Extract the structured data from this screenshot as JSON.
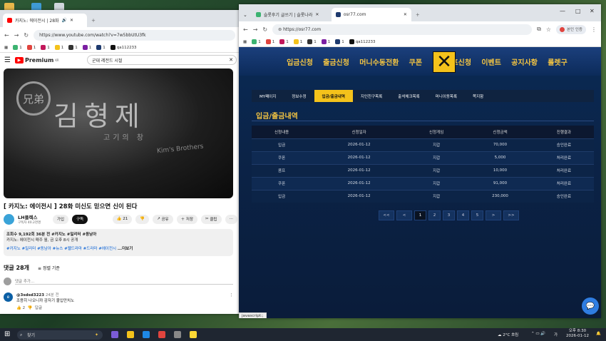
{
  "youtube_window": {
    "tab_title": "카지노: 에이전시 | 28화",
    "url": "https://www.youtube.com/watch?v=7w5bbUtU3fk",
    "bookmarks": [
      "1",
      "1",
      "1",
      "1",
      "1",
      "1",
      "1",
      "qa112233"
    ],
    "logo": "Premium",
    "logo_suffix": "KR",
    "search_query": "군대 레전드 시절",
    "video_sign_main": "김형제",
    "video_sign_round": "兄弟",
    "video_sign_sub": "고기의 창",
    "video_sign_eng": "Kim's Brothers",
    "video_title": "[ 카지노: 에이전시 ] 28화 미신도 믿으면 신이 된다",
    "channel_name": "LH플렉스",
    "channel_subs": "구독자 40.2천명",
    "join_label": "가입",
    "subscribe_label": "구독",
    "like_count": "21",
    "share_label": "공유",
    "save_label": "저장",
    "clip_label": "클립",
    "description_meta": "조회수 9,192회  36분 전  #카지노 #밀리터 #동남아",
    "description_line": "카지노: 에이전시 매주 월, 금 오후 8시 공개",
    "description_tags": "#카지노 #밀리터 #동남아 #뉴스 #웹드라마 #드라마 #에이전시",
    "more_label": "...더보기",
    "comments_heading": "댓글 28개",
    "sort_label": "정렬 기준",
    "comment_placeholder": "댓글 추가...",
    "comment_author": "@3sdsd3223",
    "comment_time": "24분 전",
    "comment_text": "조용히 나오니까 감자기 불입만치노",
    "comment_likes": "2",
    "reply_label": "답글"
  },
  "casino_window": {
    "tab1_title": "슬롯후기 글쓰기 | 슬롯나라",
    "tab2_title": "osr77.com",
    "url": "https://osr77.com",
    "bookmarks": [
      "1",
      "1",
      "1",
      "1",
      "1",
      "1",
      "1",
      "qa112233"
    ],
    "profile_label": "본인 인증",
    "top_nav": [
      "입금신청",
      "출금신청",
      "머니수동전환",
      "쿠폰",
      "콤프신청",
      "이벤트",
      "공지사항",
      "롤렛구"
    ],
    "close_glyph": "✕",
    "sub_nav": [
      "MY페이지",
      "정보수정",
      "입금/출금내역",
      "지인친구목록",
      "출석체크목록",
      "머니이동목록",
      "쪽지함"
    ],
    "sub_nav_active": 2,
    "page_title": "입금/출금내역",
    "table_headers": [
      "신청내용",
      "신청일자",
      "신청게임",
      "신청금액",
      "진행결과"
    ],
    "rows": [
      [
        "입금",
        "2026-01-12",
        "지갑",
        "70,000",
        "승인완료"
      ],
      [
        "쿠폰",
        "2026-01-12",
        "지갑",
        "5,000",
        "처리완료"
      ],
      [
        "콤프",
        "2026-01-12",
        "지갑",
        "10,000",
        "처리완료"
      ],
      [
        "쿠폰",
        "2026-01-12",
        "지갑",
        "91,000",
        "처리완료"
      ],
      [
        "입금",
        "2026-01-12",
        "지갑",
        "230,000",
        "승인완료"
      ]
    ],
    "pager": [
      "<<",
      "<",
      "1",
      "2",
      "3",
      "4",
      "5",
      ">",
      ">>"
    ],
    "pager_current": "1",
    "status_text": "javascript:;"
  },
  "taskbar": {
    "search_placeholder": "찾기",
    "weather": "2°C 흐림",
    "ime": "가",
    "time": "오후 8:30",
    "date": "2026-01-12"
  },
  "colors": {
    "accent_gold": "#f4c542",
    "site_navy": "#0b2347",
    "youtube_red": "#ff0000",
    "subscribe_black": "#111111"
  }
}
